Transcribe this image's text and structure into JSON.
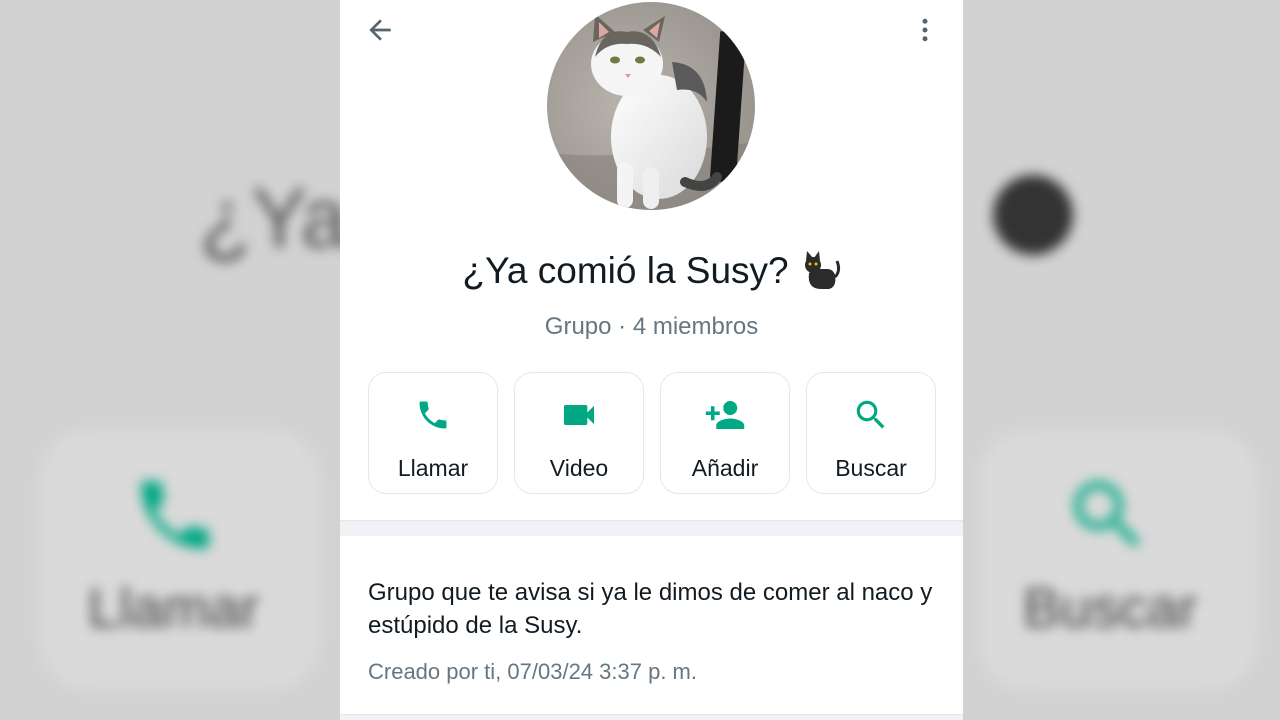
{
  "header": {
    "back_icon": "arrow-left-icon",
    "menu_icon": "more-vertical-icon"
  },
  "group": {
    "title": "¿Ya comió la Susy?",
    "title_emoji": "black-cat-emoji",
    "subtitle": "Grupo · 4 miembros",
    "avatar": "cat-photo"
  },
  "actions": [
    {
      "label": "Llamar",
      "icon": "phone-icon"
    },
    {
      "label": "Video",
      "icon": "video-icon"
    },
    {
      "label": "Añadir",
      "icon": "add-person-icon"
    },
    {
      "label": "Buscar",
      "icon": "search-icon"
    }
  ],
  "description": {
    "text": "Grupo que te avisa si ya le dimos de comer al naco y estúpido de la Susy.",
    "created": "Creado por ti, 07/03/24 3:37 p. m."
  },
  "colors": {
    "accent": "#00a884",
    "text_primary": "#111b21",
    "text_secondary": "#667781"
  }
}
